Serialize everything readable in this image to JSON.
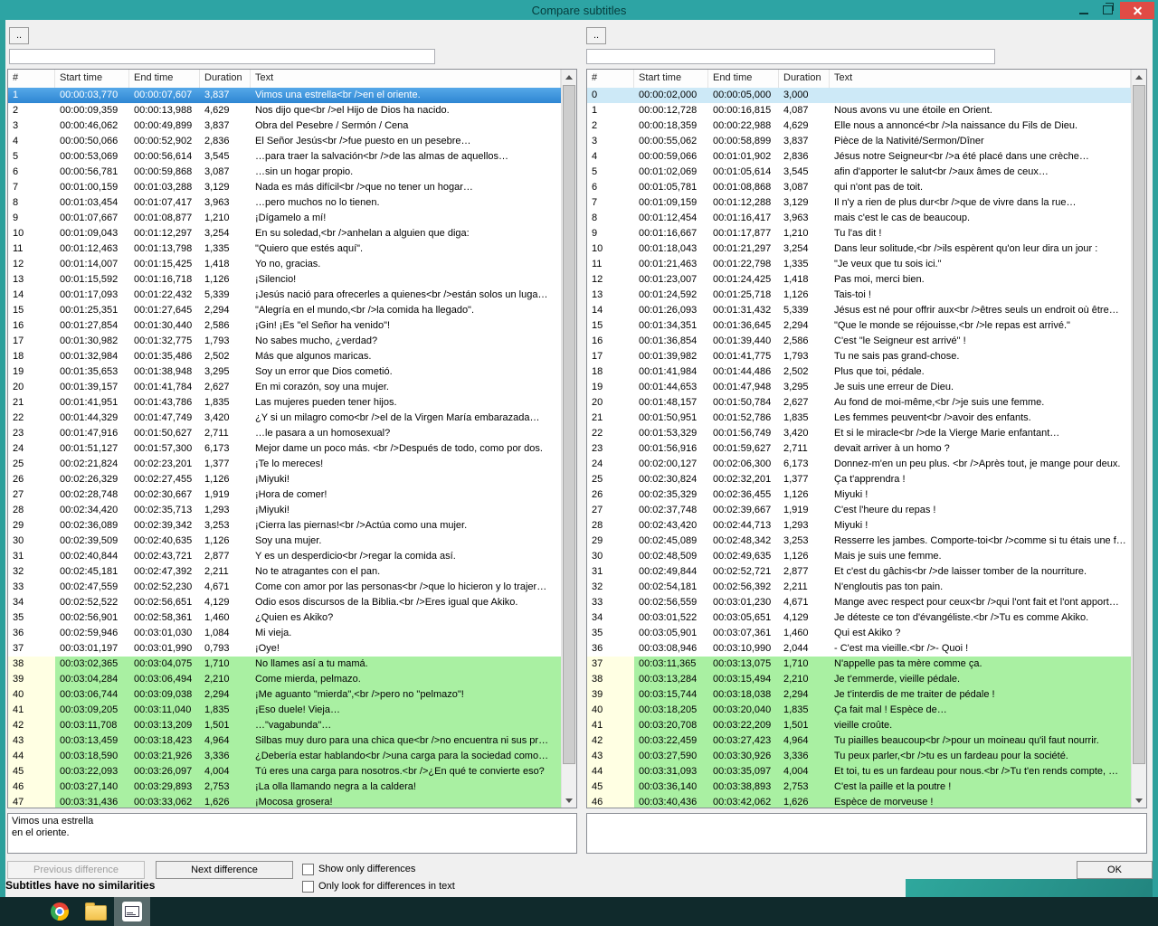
{
  "window": {
    "title": "Compare subtitles"
  },
  "columns": [
    "#",
    "Start time",
    "End time",
    "Duration",
    "Text"
  ],
  "left_panel": {
    "browse": "..",
    "file": "",
    "preview": "Vimos una estrella\nen el oriente.",
    "rows": [
      [
        "1",
        "00:00:03,770",
        "00:00:07,607",
        "3,837",
        "Vimos una estrella<br />en el oriente.",
        "sel"
      ],
      [
        "2",
        "00:00:09,359",
        "00:00:13,988",
        "4,629",
        "Nos dijo que<br />el Hijo de Dios ha nacido."
      ],
      [
        "3",
        "00:00:46,062",
        "00:00:49,899",
        "3,837",
        "Obra del Pesebre / Sermón / Cena"
      ],
      [
        "4",
        "00:00:50,066",
        "00:00:52,902",
        "2,836",
        "El Señor Jesús<br />fue puesto en un pesebre…"
      ],
      [
        "5",
        "00:00:53,069",
        "00:00:56,614",
        "3,545",
        "…para traer la salvación<br />de las almas de aquellos…"
      ],
      [
        "6",
        "00:00:56,781",
        "00:00:59,868",
        "3,087",
        "…sin un hogar propio."
      ],
      [
        "7",
        "00:01:00,159",
        "00:01:03,288",
        "3,129",
        "Nada es más difícil<br />que no tener un hogar…"
      ],
      [
        "8",
        "00:01:03,454",
        "00:01:07,417",
        "3,963",
        "…pero muchos no lo tienen."
      ],
      [
        "9",
        "00:01:07,667",
        "00:01:08,877",
        "1,210",
        "¡Dígamelo a mí!"
      ],
      [
        "10",
        "00:01:09,043",
        "00:01:12,297",
        "3,254",
        "En su soledad,<br />anhelan a alguien que diga:"
      ],
      [
        "11",
        "00:01:12,463",
        "00:01:13,798",
        "1,335",
        "\"Quiero que estés aquí\"."
      ],
      [
        "12",
        "00:01:14,007",
        "00:01:15,425",
        "1,418",
        "Yo no, gracias."
      ],
      [
        "13",
        "00:01:15,592",
        "00:01:16,718",
        "1,126",
        "¡Silencio!"
      ],
      [
        "14",
        "00:01:17,093",
        "00:01:22,432",
        "5,339",
        "¡Jesús nació para ofrecerles a quienes<br />están solos un luga…"
      ],
      [
        "15",
        "00:01:25,351",
        "00:01:27,645",
        "2,294",
        "\"Alegría en el mundo,<br />la comida ha llegado\"."
      ],
      [
        "16",
        "00:01:27,854",
        "00:01:30,440",
        "2,586",
        "¡Gin! ¡Es \"el Señor ha venido\"!"
      ],
      [
        "17",
        "00:01:30,982",
        "00:01:32,775",
        "1,793",
        "No sabes mucho, ¿verdad?"
      ],
      [
        "18",
        "00:01:32,984",
        "00:01:35,486",
        "2,502",
        "Más que algunos maricas."
      ],
      [
        "19",
        "00:01:35,653",
        "00:01:38,948",
        "3,295",
        "Soy un error que Dios cometió."
      ],
      [
        "20",
        "00:01:39,157",
        "00:01:41,784",
        "2,627",
        "En mi corazón, soy una mujer."
      ],
      [
        "21",
        "00:01:41,951",
        "00:01:43,786",
        "1,835",
        "Las mujeres pueden tener hijos."
      ],
      [
        "22",
        "00:01:44,329",
        "00:01:47,749",
        "3,420",
        "¿Y si un milagro como<br />el de la Virgen María embarazada…"
      ],
      [
        "23",
        "00:01:47,916",
        "00:01:50,627",
        "2,711",
        "…le pasara a un homosexual?"
      ],
      [
        "24",
        "00:01:51,127",
        "00:01:57,300",
        "6,173",
        "Mejor dame un poco más. <br />Después de todo, como por dos."
      ],
      [
        "25",
        "00:02:21,824",
        "00:02:23,201",
        "1,377",
        "¡Te lo mereces!"
      ],
      [
        "26",
        "00:02:26,329",
        "00:02:27,455",
        "1,126",
        "¡Miyuki!"
      ],
      [
        "27",
        "00:02:28,748",
        "00:02:30,667",
        "1,919",
        "¡Hora de comer!"
      ],
      [
        "28",
        "00:02:34,420",
        "00:02:35,713",
        "1,293",
        "¡Miyuki!"
      ],
      [
        "29",
        "00:02:36,089",
        "00:02:39,342",
        "3,253",
        "¡Cierra las piernas!<br />Actúa como una mujer."
      ],
      [
        "30",
        "00:02:39,509",
        "00:02:40,635",
        "1,126",
        "Soy una mujer."
      ],
      [
        "31",
        "00:02:40,844",
        "00:02:43,721",
        "2,877",
        "Y es un desperdicio<br />regar la comida así."
      ],
      [
        "32",
        "00:02:45,181",
        "00:02:47,392",
        "2,211",
        "No te atragantes con el pan."
      ],
      [
        "33",
        "00:02:47,559",
        "00:02:52,230",
        "4,671",
        "Come con amor por las personas<br />que lo hicieron y lo trajer…"
      ],
      [
        "34",
        "00:02:52,522",
        "00:02:56,651",
        "4,129",
        "Odio esos discursos de la Biblia.<br />Eres igual que Akiko."
      ],
      [
        "35",
        "00:02:56,901",
        "00:02:58,361",
        "1,460",
        "¿Quien es Akiko?"
      ],
      [
        "36",
        "00:02:59,946",
        "00:03:01,030",
        "1,084",
        "Mi vieja."
      ],
      [
        "37",
        "00:03:01,197",
        "00:03:01,990",
        "0,793",
        "¡Oye!"
      ],
      [
        "38",
        "00:03:02,365",
        "00:03:04,075",
        "1,710",
        "No llames así a tu mamá.",
        "green"
      ],
      [
        "39",
        "00:03:04,284",
        "00:03:06,494",
        "2,210",
        "Come mierda, pelmazo.",
        "green"
      ],
      [
        "40",
        "00:03:06,744",
        "00:03:09,038",
        "2,294",
        "¡Me aguanto \"mierda\",<br />pero no \"pelmazo\"!",
        "green"
      ],
      [
        "41",
        "00:03:09,205",
        "00:03:11,040",
        "1,835",
        "¡Eso duele! Vieja…",
        "green"
      ],
      [
        "42",
        "00:03:11,708",
        "00:03:13,209",
        "1,501",
        "…\"vagabunda\"…",
        "green"
      ],
      [
        "43",
        "00:03:13,459",
        "00:03:18,423",
        "4,964",
        "Silbas muy duro para una chica que<br />no encuentra ni sus pr…",
        "green"
      ],
      [
        "44",
        "00:03:18,590",
        "00:03:21,926",
        "3,336",
        "¿Debería estar hablando<br />una carga para la sociedad como…",
        "green"
      ],
      [
        "45",
        "00:03:22,093",
        "00:03:26,097",
        "4,004",
        "Tú eres una carga para nosotros.<br />¿En qué te convierte eso?",
        "green"
      ],
      [
        "46",
        "00:03:27,140",
        "00:03:29,893",
        "2,753",
        "¡La olla llamando negra a la caldera!",
        "green"
      ],
      [
        "47",
        "00:03:31,436",
        "00:03:33,062",
        "1,626",
        "¡Mocosa grosera!",
        "green"
      ]
    ]
  },
  "right_panel": {
    "browse": "..",
    "file": "",
    "preview": "",
    "rows": [
      [
        "0",
        "00:00:02,000",
        "00:00:05,000",
        "3,000",
        "",
        "hl"
      ],
      [
        "1",
        "00:00:12,728",
        "00:00:16,815",
        "4,087",
        "Nous avons vu une étoile en Orient."
      ],
      [
        "2",
        "00:00:18,359",
        "00:00:22,988",
        "4,629",
        "Elle nous a annoncé<br />la naissance du Fils de Dieu."
      ],
      [
        "3",
        "00:00:55,062",
        "00:00:58,899",
        "3,837",
        "Pièce de la Nativité/Sermon/Dîner"
      ],
      [
        "4",
        "00:00:59,066",
        "00:01:01,902",
        "2,836",
        "Jésus notre Seigneur<br />a été placé dans une crèche…"
      ],
      [
        "5",
        "00:01:02,069",
        "00:01:05,614",
        "3,545",
        "afin d'apporter le salut<br />aux âmes de ceux…"
      ],
      [
        "6",
        "00:01:05,781",
        "00:01:08,868",
        "3,087",
        "qui n'ont pas de toit."
      ],
      [
        "7",
        "00:01:09,159",
        "00:01:12,288",
        "3,129",
        "Il n'y a rien de plus dur<br />que de vivre dans la rue…"
      ],
      [
        "8",
        "00:01:12,454",
        "00:01:16,417",
        "3,963",
        "mais c'est le cas de beaucoup."
      ],
      [
        "9",
        "00:01:16,667",
        "00:01:17,877",
        "1,210",
        "Tu l'as dit !"
      ],
      [
        "10",
        "00:01:18,043",
        "00:01:21,297",
        "3,254",
        "Dans leur solitude,<br />ils espèrent qu'on leur dira un jour :"
      ],
      [
        "11",
        "00:01:21,463",
        "00:01:22,798",
        "1,335",
        "\"Je veux que tu sois ici.\""
      ],
      [
        "12",
        "00:01:23,007",
        "00:01:24,425",
        "1,418",
        "Pas moi, merci bien."
      ],
      [
        "13",
        "00:01:24,592",
        "00:01:25,718",
        "1,126",
        "Tais-toi !"
      ],
      [
        "14",
        "00:01:26,093",
        "00:01:31,432",
        "5,339",
        "Jésus est né pour offrir aux<br />êtres seuls un endroit où être…"
      ],
      [
        "15",
        "00:01:34,351",
        "00:01:36,645",
        "2,294",
        "\"Que le monde se réjouisse,<br />le repas est arrivé.\""
      ],
      [
        "16",
        "00:01:36,854",
        "00:01:39,440",
        "2,586",
        "C'est \"le Seigneur est arrivé\" !"
      ],
      [
        "17",
        "00:01:39,982",
        "00:01:41,775",
        "1,793",
        "Tu ne sais pas grand-chose."
      ],
      [
        "18",
        "00:01:41,984",
        "00:01:44,486",
        "2,502",
        "Plus que toi, pédale."
      ],
      [
        "19",
        "00:01:44,653",
        "00:01:47,948",
        "3,295",
        "Je suis une erreur de Dieu."
      ],
      [
        "20",
        "00:01:48,157",
        "00:01:50,784",
        "2,627",
        "Au fond de moi-même,<br />je suis une femme."
      ],
      [
        "21",
        "00:01:50,951",
        "00:01:52,786",
        "1,835",
        "Les femmes peuvent<br />avoir des enfants."
      ],
      [
        "22",
        "00:01:53,329",
        "00:01:56,749",
        "3,420",
        "Et si le miracle<br />de la Vierge Marie enfantant…"
      ],
      [
        "23",
        "00:01:56,916",
        "00:01:59,627",
        "2,711",
        "devait arriver à un homo ?"
      ],
      [
        "24",
        "00:02:00,127",
        "00:02:06,300",
        "6,173",
        "Donnez-m'en un peu plus. <br />Après tout, je mange pour deux."
      ],
      [
        "25",
        "00:02:30,824",
        "00:02:32,201",
        "1,377",
        "Ça t'apprendra !"
      ],
      [
        "26",
        "00:02:35,329",
        "00:02:36,455",
        "1,126",
        "Miyuki !"
      ],
      [
        "27",
        "00:02:37,748",
        "00:02:39,667",
        "1,919",
        "C'est l'heure du repas !"
      ],
      [
        "28",
        "00:02:43,420",
        "00:02:44,713",
        "1,293",
        "Miyuki !"
      ],
      [
        "29",
        "00:02:45,089",
        "00:02:48,342",
        "3,253",
        "Resserre les jambes. Comporte-toi<br />comme si tu étais une f…"
      ],
      [
        "30",
        "00:02:48,509",
        "00:02:49,635",
        "1,126",
        "Mais je suis une femme."
      ],
      [
        "31",
        "00:02:49,844",
        "00:02:52,721",
        "2,877",
        "Et c'est du gâchis<br />de laisser tomber de la nourriture."
      ],
      [
        "32",
        "00:02:54,181",
        "00:02:56,392",
        "2,211",
        "N'engloutis pas ton pain."
      ],
      [
        "33",
        "00:02:56,559",
        "00:03:01,230",
        "4,671",
        "Mange avec respect pour ceux<br />qui l'ont fait et l'ont apport…"
      ],
      [
        "34",
        "00:03:01,522",
        "00:03:05,651",
        "4,129",
        "Je déteste ce ton d'évangéliste.<br />Tu es comme Akiko."
      ],
      [
        "35",
        "00:03:05,901",
        "00:03:07,361",
        "1,460",
        "Qui est Akiko ?"
      ],
      [
        "36",
        "00:03:08,946",
        "00:03:10,990",
        "2,044",
        "- C'est ma vieille.<br />- Quoi !"
      ],
      [
        "37",
        "00:03:11,365",
        "00:03:13,075",
        "1,710",
        "N'appelle pas ta mère comme ça.",
        "green"
      ],
      [
        "38",
        "00:03:13,284",
        "00:03:15,494",
        "2,210",
        "Je t'emmerde, vieille pédale.",
        "green"
      ],
      [
        "39",
        "00:03:15,744",
        "00:03:18,038",
        "2,294",
        "Je t'interdis de me traiter de pédale !",
        "green"
      ],
      [
        "40",
        "00:03:18,205",
        "00:03:20,040",
        "1,835",
        "Ça fait mal ! Espèce de…",
        "green"
      ],
      [
        "41",
        "00:03:20,708",
        "00:03:22,209",
        "1,501",
        "vieille croûte.",
        "green"
      ],
      [
        "42",
        "00:03:22,459",
        "00:03:27,423",
        "4,964",
        "Tu piailles beaucoup<br />pour un moineau qu'il faut nourrir.",
        "green"
      ],
      [
        "43",
        "00:03:27,590",
        "00:03:30,926",
        "3,336",
        "Tu peux parler,<br />tu es un fardeau pour la société.",
        "green"
      ],
      [
        "44",
        "00:03:31,093",
        "00:03:35,097",
        "4,004",
        "Et toi, tu es un fardeau pour nous.<br />Tu t'en rends compte, …",
        "green"
      ],
      [
        "45",
        "00:03:36,140",
        "00:03:38,893",
        "2,753",
        "C'est la paille et la poutre !",
        "green"
      ],
      [
        "46",
        "00:03:40,436",
        "00:03:42,062",
        "1,626",
        "Espèce de morveuse !",
        "green"
      ]
    ]
  },
  "footer": {
    "previous_button": "Previous difference",
    "next_button": "Next difference",
    "show_only_differences": "Show only differences",
    "only_text_differences": "Only look for differences in text",
    "status": "Subtitles have no similarities",
    "ok_button": "OK"
  },
  "colors": {
    "titlebar": "#2da4a4",
    "selected_row": "#2e86d3",
    "inactive_selected_row": "#cde9f7",
    "difference_row": "#a9f0a2",
    "close_button": "#e04b45"
  },
  "taskbar": {
    "icons": [
      "chrome-icon",
      "folder-icon",
      "subtitle-app-icon"
    ]
  }
}
